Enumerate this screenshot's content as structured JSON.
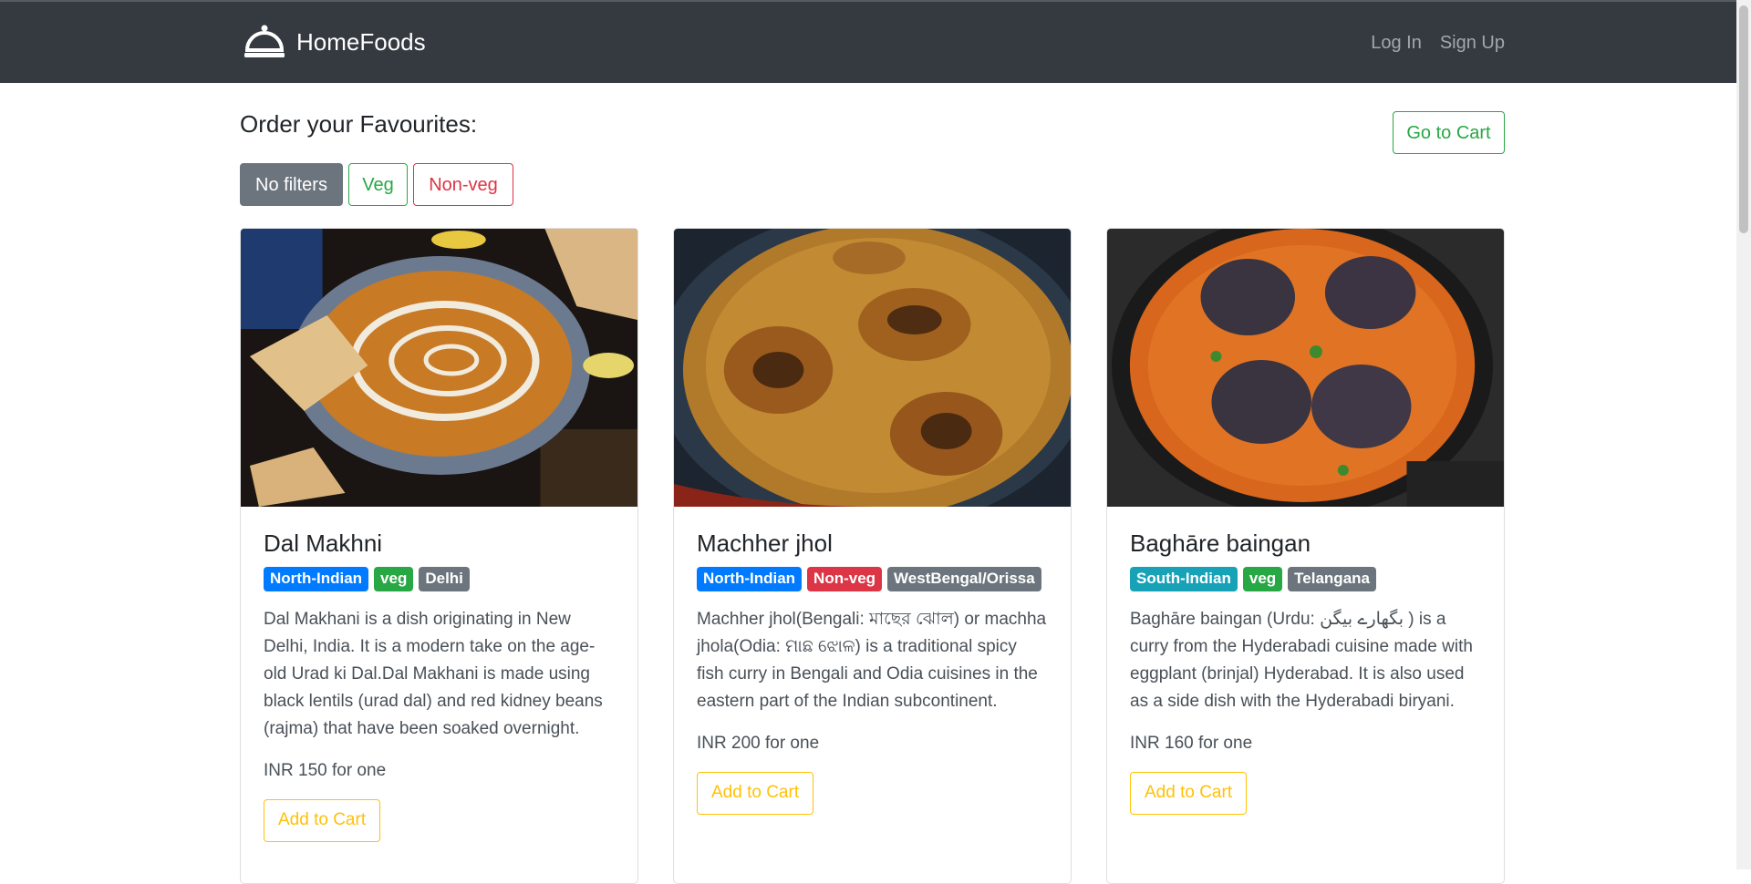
{
  "nav": {
    "brand": "HomeFoods",
    "login": "Log In",
    "signup": "Sign Up"
  },
  "page": {
    "title": "Order your Favourites:",
    "go_to_cart": "Go to Cart"
  },
  "filters": {
    "none": "No filters",
    "veg": "Veg",
    "nonveg": "Non-veg"
  },
  "cards": [
    {
      "title": "Dal Makhni",
      "badges": [
        "North-Indian",
        "veg",
        "Delhi"
      ],
      "badge_colors": [
        "#007bff",
        "#28a745",
        "#6c757d"
      ],
      "description": "Dal Makhani is a dish originating in New Delhi, India. It is a modern take on the age-old Urad ki Dal.Dal Makhani is made using black lentils (urad dal) and red kidney beans (rajma) that have been soaked overnight.",
      "price": "INR 150 for one",
      "add_label": "Add to Cart"
    },
    {
      "title": "Machher jhol",
      "badges": [
        "North-Indian",
        "Non-veg",
        "WestBengal/Orissa"
      ],
      "badge_colors": [
        "#007bff",
        "#dc3545",
        "#6c757d"
      ],
      "description": "Machher jhol(Bengali: মাছের ঝোল) or machha jhola(Odia: ମାଛ ଝୋଳ) is a traditional spicy fish curry in Bengali and Odia cuisines in the eastern part of the Indian subcontinent.",
      "price": "INR 200 for one",
      "add_label": "Add to Cart"
    },
    {
      "title": "Baghāre baingan",
      "badges": [
        "South-Indian",
        "veg",
        "Telangana"
      ],
      "badge_colors": [
        "#17a2b8",
        "#28a745",
        "#6c757d"
      ],
      "description": "Baghāre baingan (Urdu: بگھارے بیگن ) is a curry from the Hyderabadi cuisine made with eggplant (brinjal) Hyderabad. It is also used as a side dish with the Hyderabadi biryani.",
      "price": "INR 160 for one",
      "add_label": "Add to Cart"
    }
  ]
}
